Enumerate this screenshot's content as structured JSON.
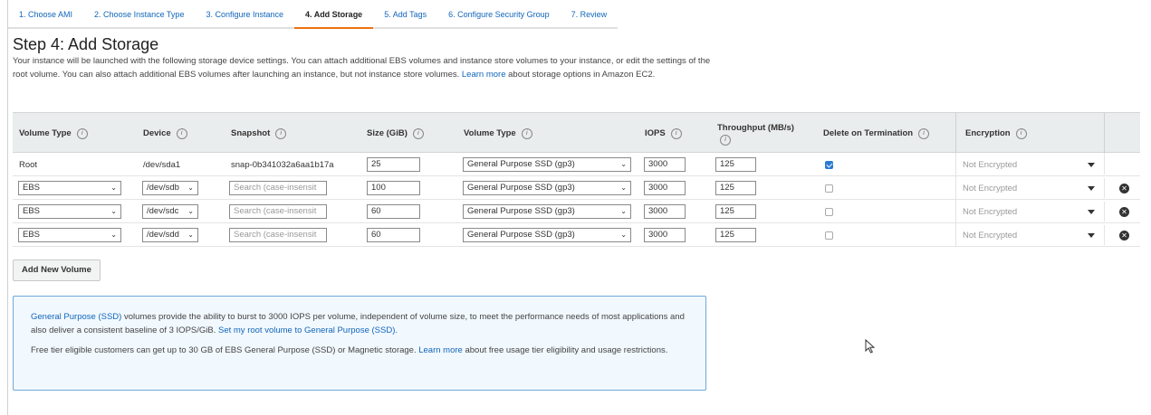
{
  "wizard": {
    "tabs": [
      {
        "label": "1. Choose AMI"
      },
      {
        "label": "2. Choose Instance Type"
      },
      {
        "label": "3. Configure Instance"
      },
      {
        "label": "4. Add Storage"
      },
      {
        "label": "5. Add Tags"
      },
      {
        "label": "6. Configure Security Group"
      },
      {
        "label": "7. Review"
      }
    ],
    "active_index": 3
  },
  "page": {
    "title": "Step 4: Add Storage",
    "intro_text": "Your instance will be launched with the following storage device settings. You can attach additional EBS volumes and instance store volumes to your instance, or edit the settings of the root volume. You can also attach additional EBS volumes after launching an instance, but not instance store volumes.",
    "intro_link": "Learn more",
    "intro_suffix": "about storage options in Amazon EC2."
  },
  "table": {
    "headers": {
      "volume_type": "Volume Type",
      "device": "Device",
      "snapshot": "Snapshot",
      "size": "Size (GiB)",
      "volume_type2": "Volume Type",
      "iops": "IOPS",
      "throughput": "Throughput (MB/s)",
      "delete_on_termination": "Delete on Termination",
      "encryption": "Encryption"
    },
    "info_glyph": "i",
    "root_row": {
      "volume_type": "Root",
      "device": "/dev/sda1",
      "snapshot": "snap-0b341032a6aa1b17a",
      "size": "25",
      "ebs_type": "General Purpose SSD (gp3)",
      "iops": "3000",
      "throughput": "125",
      "delete_on_termination": true,
      "encryption": "Not Encrypted"
    },
    "ebs_rows": [
      {
        "volume_type": "EBS",
        "device": "/dev/sdb",
        "snapshot_placeholder": "Search (case-insensit",
        "size": "100",
        "ebs_type": "General Purpose SSD (gp3)",
        "iops": "3000",
        "throughput": "125",
        "delete_on_termination": false,
        "encryption": "Not Encrypted"
      },
      {
        "volume_type": "EBS",
        "device": "/dev/sdc",
        "snapshot_placeholder": "Search (case-insensit",
        "size": "60",
        "ebs_type": "General Purpose SSD (gp3)",
        "iops": "3000",
        "throughput": "125",
        "delete_on_termination": false,
        "encryption": "Not Encrypted"
      },
      {
        "volume_type": "EBS",
        "device": "/dev/sdd",
        "snapshot_placeholder": "Search (case-insensit",
        "size": "60",
        "ebs_type": "General Purpose SSD (gp3)",
        "iops": "3000",
        "throughput": "125",
        "delete_on_termination": false,
        "encryption": "Not Encrypted"
      }
    ]
  },
  "actions": {
    "add_volume_label": "Add New Volume"
  },
  "info_box": {
    "p1_link": "General Purpose (SSD)",
    "p1_text": "volumes provide the ability to burst to 3000 IOPS per volume, independent of volume size, to meet the performance needs of most applications and also deliver a consistent baseline of 3 IOPS/GiB.",
    "p1_link2": "Set my root volume to General Purpose (SSD).",
    "p2_text": "Free tier eligible customers can get up to 30 GB of EBS General Purpose (SSD) or Magnetic storage.",
    "p2_link": "Learn more",
    "p2_suffix": "about free usage tier eligibility and usage restrictions."
  },
  "icons": {
    "chevron": "chevron-down-icon",
    "remove": "remove-circle-icon",
    "cursor": "mouse-pointer-icon"
  },
  "colors": {
    "link": "#1166bb",
    "active_tab": "#ec7211",
    "checkbox_checked": "#2b7bd3",
    "info_border": "#6fa8d8",
    "info_bg": "#f1f8fe"
  }
}
